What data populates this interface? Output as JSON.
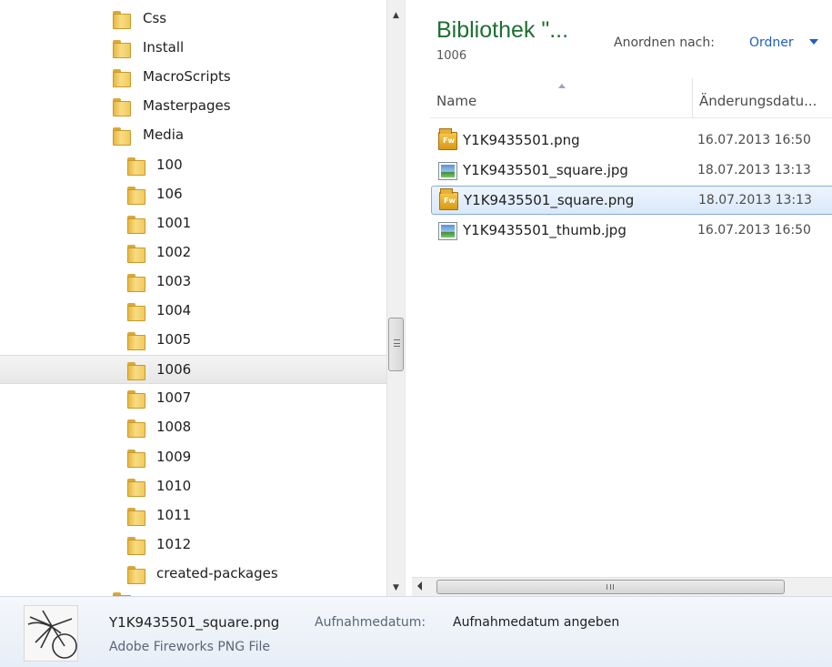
{
  "nav": {
    "items": [
      {
        "label": "Css",
        "level": 1,
        "selected": false
      },
      {
        "label": "Install",
        "level": 1,
        "selected": false
      },
      {
        "label": "MacroScripts",
        "level": 1,
        "selected": false
      },
      {
        "label": "Masterpages",
        "level": 1,
        "selected": false
      },
      {
        "label": "Media",
        "level": 1,
        "selected": false
      },
      {
        "label": "100",
        "level": 2,
        "selected": false
      },
      {
        "label": "106",
        "level": 2,
        "selected": false
      },
      {
        "label": "1001",
        "level": 2,
        "selected": false
      },
      {
        "label": "1002",
        "level": 2,
        "selected": false
      },
      {
        "label": "1003",
        "level": 2,
        "selected": false
      },
      {
        "label": "1004",
        "level": 2,
        "selected": false
      },
      {
        "label": "1005",
        "level": 2,
        "selected": false
      },
      {
        "label": "1006",
        "level": 2,
        "selected": true
      },
      {
        "label": "1007",
        "level": 2,
        "selected": false
      },
      {
        "label": "1008",
        "level": 2,
        "selected": false
      },
      {
        "label": "1009",
        "level": 2,
        "selected": false
      },
      {
        "label": "1010",
        "level": 2,
        "selected": false
      },
      {
        "label": "1011",
        "level": 2,
        "selected": false
      },
      {
        "label": "1012",
        "level": 2,
        "selected": false
      },
      {
        "label": "created-packages",
        "level": 2,
        "selected": false
      }
    ],
    "icon": "folder-icon"
  },
  "library": {
    "title": "Bibliothek \"...",
    "subtitle": "1006",
    "arrange_label": "Anordnen nach:",
    "arrange_value": "Ordner"
  },
  "columns": {
    "name": "Name",
    "date": "Änderungsdatu..."
  },
  "files": [
    {
      "name": "Y1K9435501.png",
      "date": "16.07.2013 16:50",
      "icon": "fireworks-png-icon",
      "selected": false
    },
    {
      "name": "Y1K9435501_square.jpg",
      "date": "18.07.2013 13:13",
      "icon": "jpg-image-icon",
      "selected": false
    },
    {
      "name": "Y1K9435501_square.png",
      "date": "18.07.2013 13:13",
      "icon": "fireworks-png-icon",
      "selected": true
    },
    {
      "name": "Y1K9435501_thumb.jpg",
      "date": "16.07.2013 16:50",
      "icon": "jpg-image-icon",
      "selected": false
    }
  ],
  "details": {
    "filename": "Y1K9435501_square.png",
    "property_label": "Aufnahmedatum:",
    "property_value": "Aufnahmedatum angeben",
    "file_type": "Adobe Fireworks PNG File"
  },
  "colors": {
    "library_title": "#1e6f33",
    "link_blue": "#1f5fbf",
    "selection_border": "#84acdd"
  }
}
